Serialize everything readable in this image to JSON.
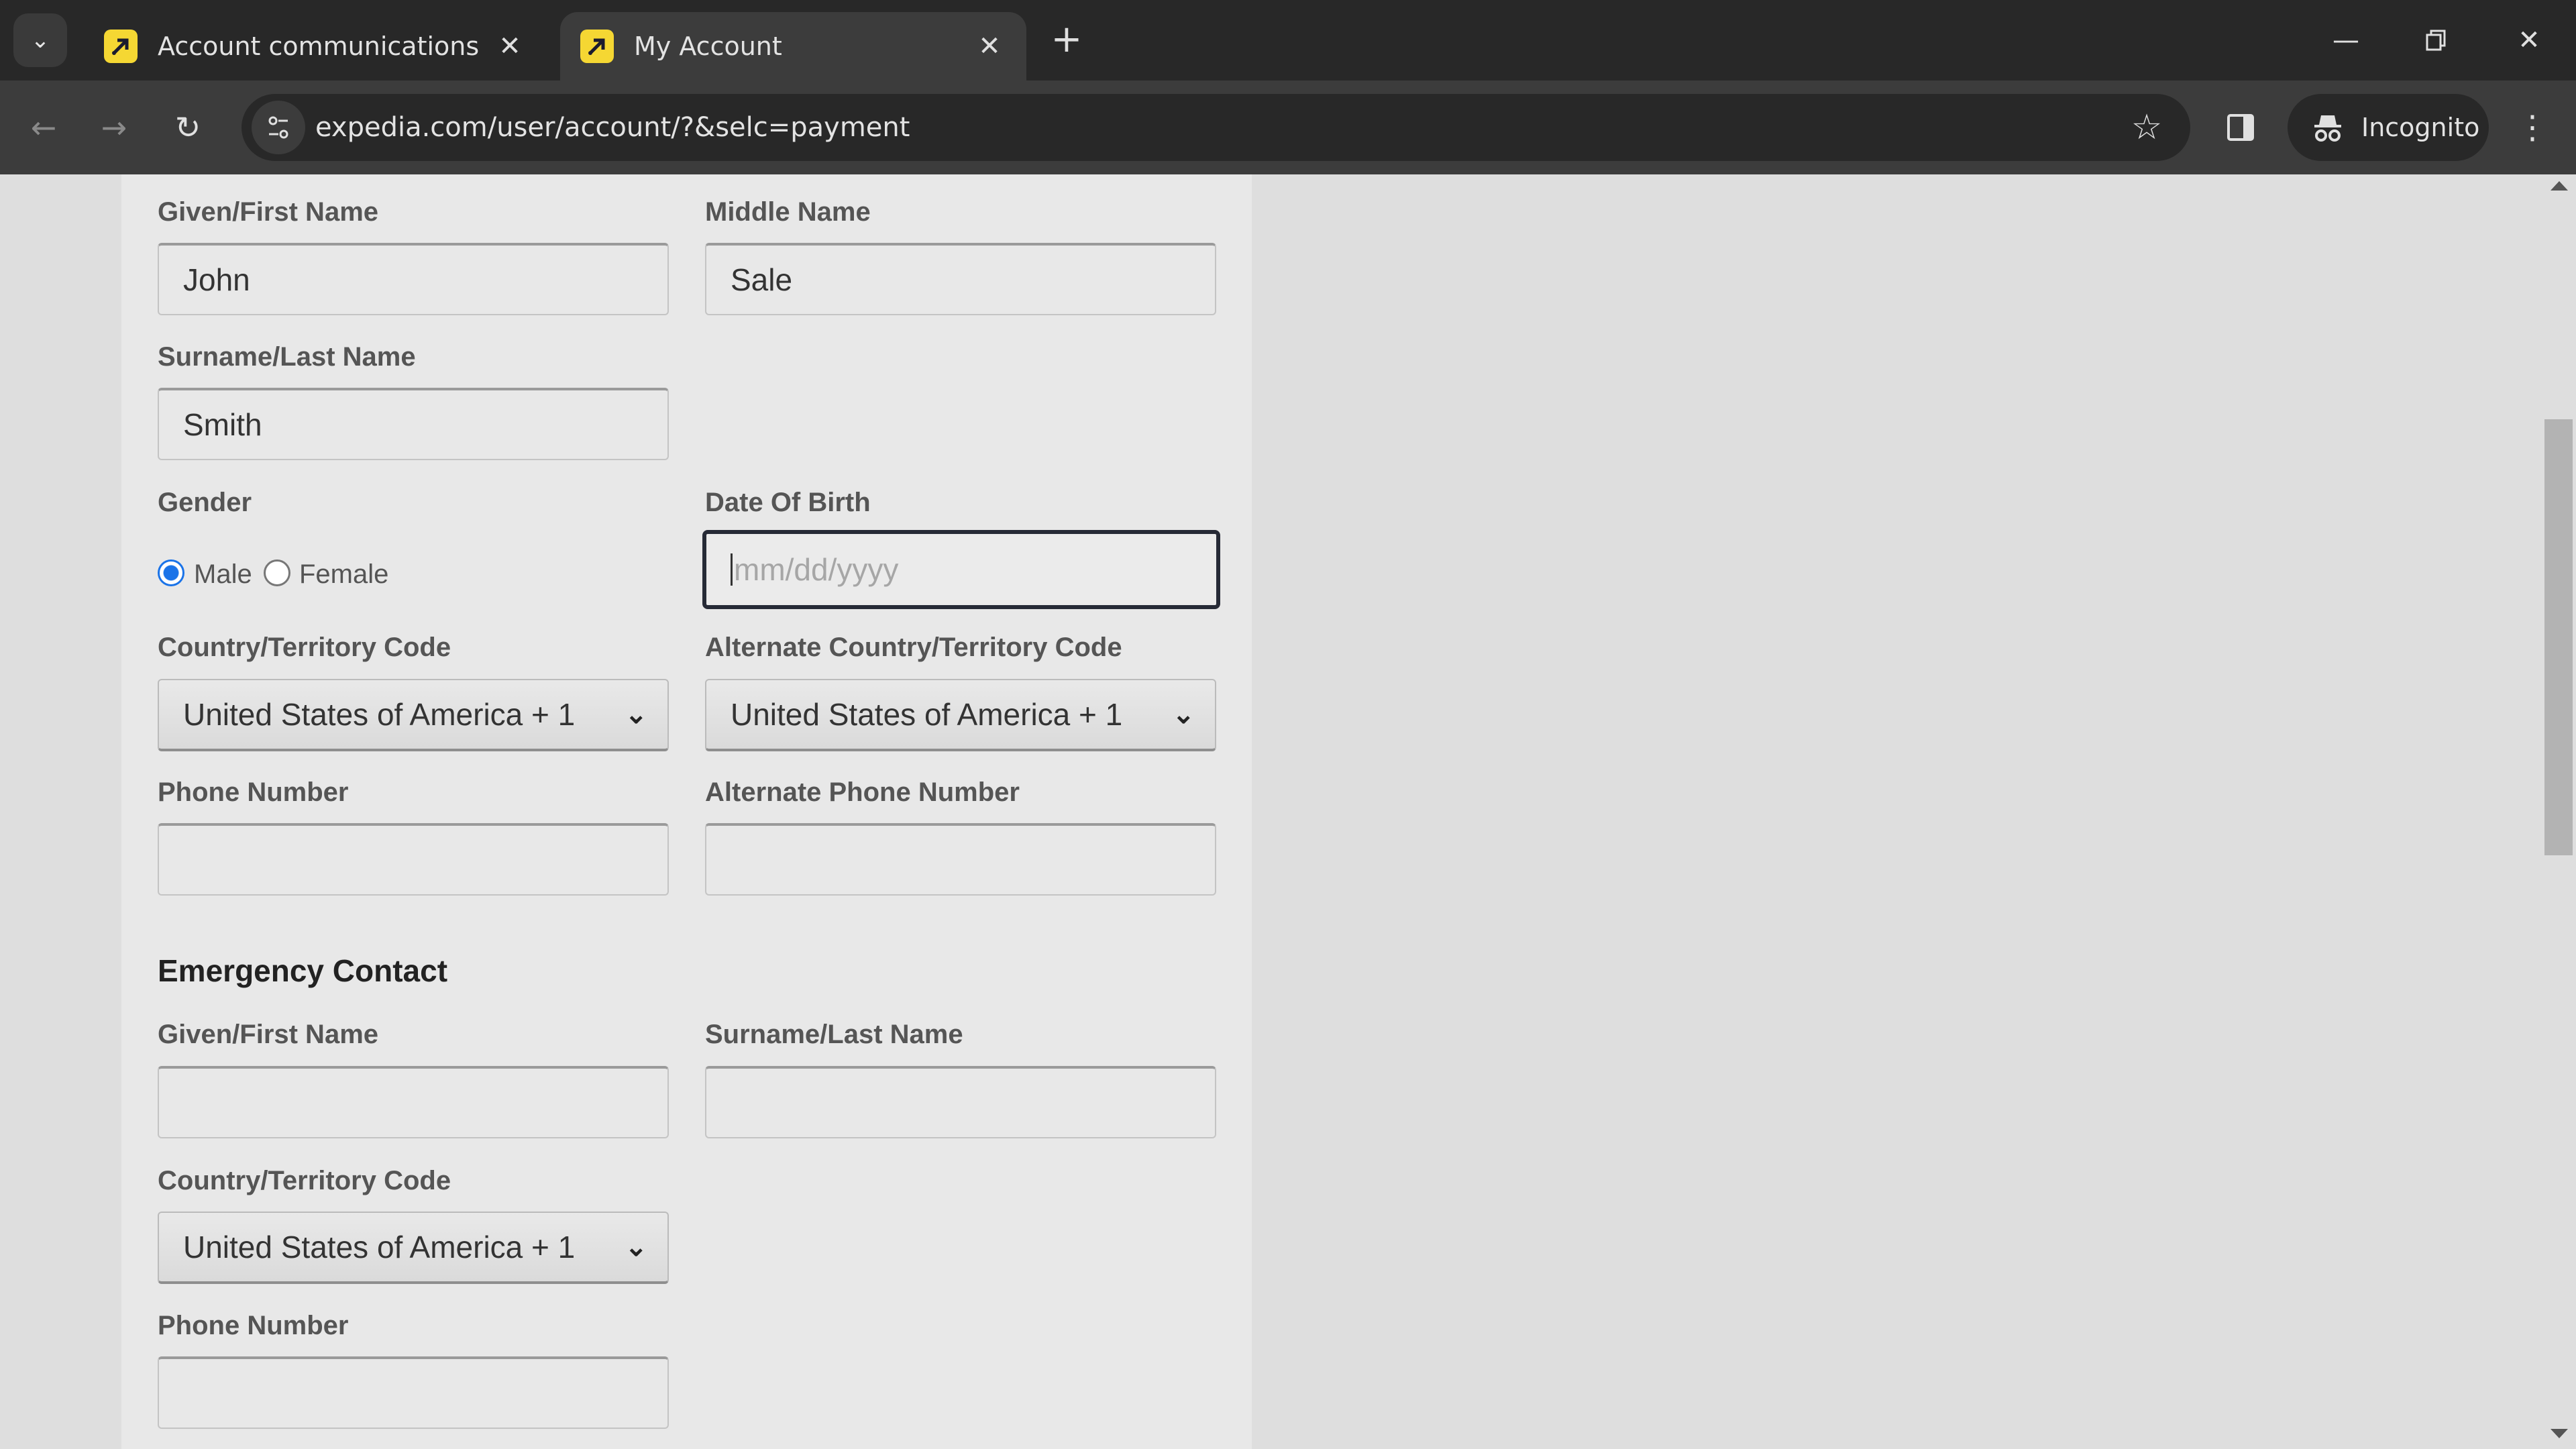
{
  "browser": {
    "tabs": [
      {
        "title": "Account communications",
        "active": false
      },
      {
        "title": "My Account",
        "active": true
      }
    ],
    "url": "expedia.com/user/account/?&selc=payment",
    "incognito_label": "Incognito",
    "accent_favicon": "#f5d733"
  },
  "form": {
    "traveler": {
      "first_name": {
        "label": "Given/First Name",
        "value": "John"
      },
      "middle_name": {
        "label": "Middle Name",
        "value": "Sale"
      },
      "last_name": {
        "label": "Surname/Last Name",
        "value": "Smith"
      },
      "gender": {
        "label": "Gender",
        "options": [
          "Male",
          "Female"
        ],
        "selected": "Male"
      },
      "dob": {
        "label": "Date Of Birth",
        "placeholder": "mm/dd/yyyy",
        "value": ""
      },
      "country_code": {
        "label": "Country/Territory Code",
        "value": "United States of America + 1"
      },
      "alt_country_code": {
        "label": "Alternate Country/Territory Code",
        "value": "United States of America + 1"
      },
      "phone": {
        "label": "Phone Number",
        "value": ""
      },
      "alt_phone": {
        "label": "Alternate Phone Number",
        "value": ""
      }
    },
    "emergency": {
      "title": "Emergency Contact",
      "first_name": {
        "label": "Given/First Name",
        "value": ""
      },
      "last_name": {
        "label": "Surname/Last Name",
        "value": ""
      },
      "country_code": {
        "label": "Country/Territory Code",
        "value": "United States of America + 1"
      },
      "phone": {
        "label": "Phone Number",
        "value": ""
      }
    }
  }
}
